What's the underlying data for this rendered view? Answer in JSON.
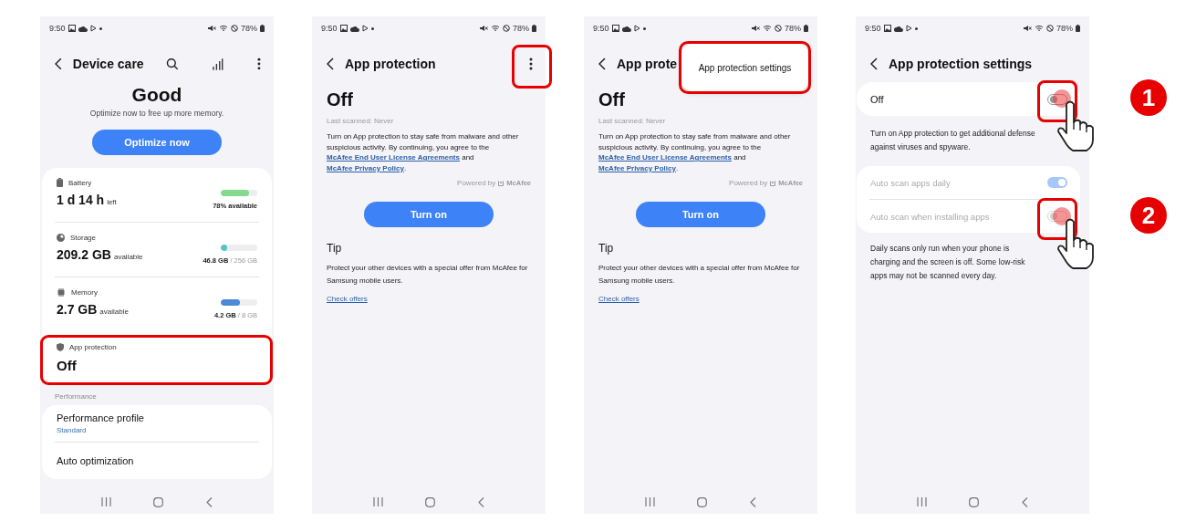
{
  "screens": [
    {
      "kind": "device_care",
      "status_bar": {
        "time": "9:50",
        "battery": "78%"
      },
      "title": "Device care",
      "status": "Good",
      "subtitle": "Optimize now to free up more memory.",
      "button": "Optimize now",
      "items": [
        {
          "kind": "meter",
          "label": "Battery",
          "value": "1 d 14 h",
          "unit": "left",
          "level": 0.78,
          "color": "#86da8f",
          "reading": "78% available"
        },
        {
          "kind": "meter",
          "label": "Storage",
          "value": "209.2 GB",
          "unit": "available",
          "level": 0.18,
          "color": "#52c6c6",
          "reading": "46.8 GB",
          "total": " / 256 GB"
        },
        {
          "kind": "meter",
          "label": "Memory",
          "value": "2.7 GB",
          "unit": "available",
          "level": 0.52,
          "color": "#4a8ad8",
          "reading": "4.2 GB",
          "total": " / 8 GB"
        },
        {
          "kind": "status",
          "label": "App protection",
          "value": "Off",
          "highlighted": true
        }
      ],
      "section": "Performance",
      "settings": [
        {
          "title": "Performance profile",
          "subtitle": "Standard"
        },
        {
          "title": "Auto optimization"
        }
      ]
    },
    {
      "kind": "app_protection",
      "status_bar": {
        "time": "9:50",
        "battery": "78%"
      },
      "title": "App protection",
      "more_highlighted": true,
      "status": "Off",
      "last_scanned": "Last scanned: Never",
      "description": [
        {
          "kind": "text",
          "text": "Turn on App protection to stay safe from malware and other suspicious activity. By continuing, you agree to the "
        },
        {
          "kind": "link",
          "text": "McAfee End User License Agreements"
        },
        {
          "kind": "text",
          "text": " and "
        },
        {
          "kind": "link",
          "text": "McAfee Privacy Policy"
        },
        {
          "kind": "text",
          "text": "."
        }
      ],
      "powered_by": "Powered by",
      "brand": "McAfee",
      "button": "Turn on",
      "tip_title": "Tip",
      "tip": "Protect your other devices with a special offer from McAfee for Samsung mobile users.",
      "tip_link": "Check offers"
    },
    {
      "kind": "app_protection",
      "status_bar": {
        "time": "9:50",
        "battery": "78%"
      },
      "title": "App prote",
      "menu": {
        "item": "App protection settings",
        "highlighted": true
      },
      "status": "Off",
      "last_scanned": "Last scanned: Never",
      "description": [
        {
          "kind": "text",
          "text": "Turn on App protection to stay safe from malware and other suspicious activity. By continuing, you agree to the "
        },
        {
          "kind": "link",
          "text": "McAfee End User License Agreements"
        },
        {
          "kind": "text",
          "text": " and "
        },
        {
          "kind": "link",
          "text": "McAfee Privacy Policy"
        },
        {
          "kind": "text",
          "text": "."
        }
      ],
      "powered_by": "Powered by",
      "brand": "McAfee",
      "button": "Turn on",
      "tip_title": "Tip",
      "tip": "Protect your other devices with a special offer from McAfee for Samsung mobile users.",
      "tip_link": "Check offers"
    },
    {
      "kind": "settings",
      "status_bar": {
        "time": "9:50",
        "battery": "78%"
      },
      "title": "App protection settings",
      "master": {
        "label": "Off",
        "on": false,
        "highlighted": true,
        "step": "1"
      },
      "master_note": "Turn on App protection to get additional defense against viruses and spyware.",
      "options": [
        {
          "label": "Auto scan apps daily",
          "on": true,
          "disabled": true,
          "highlighted": false
        },
        {
          "label": "Auto scan when installing apps",
          "on": false,
          "disabled": true,
          "highlighted": true,
          "step": "2"
        }
      ],
      "note": "Daily scans only run when your phone is charging and the screen is off. Some low-risk apps may not be scanned every day."
    }
  ]
}
